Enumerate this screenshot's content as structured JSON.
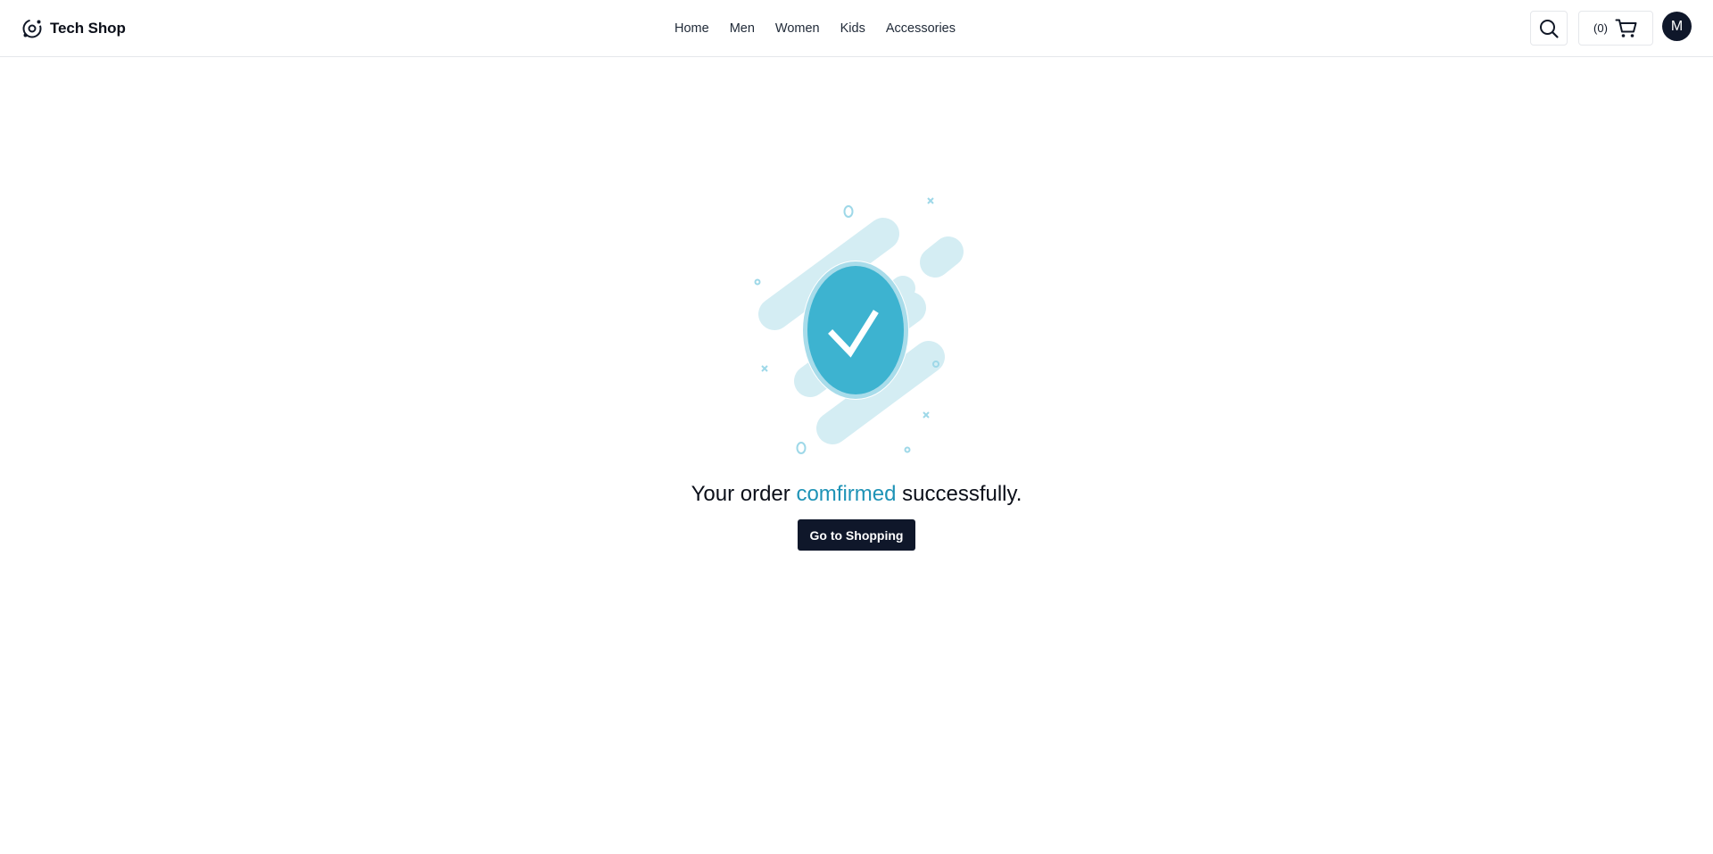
{
  "header": {
    "brand": "Tech Shop",
    "nav": [
      "Home",
      "Men",
      "Women",
      "Kids",
      "Accessories"
    ],
    "cart_count": "(0)",
    "avatar_initial": "M"
  },
  "main": {
    "message_prefix": "Your order",
    "message_accent": "comfirmed",
    "message_suffix": "successfully.",
    "button_label": "Go to Shopping"
  },
  "colors": {
    "primary": "#0f172a",
    "accent": "#1e93b6",
    "badge": "#3db3d0",
    "illustration_light": "#d4edf3"
  },
  "icons": {
    "brand": "brand-logo-icon",
    "search": "search-icon",
    "cart": "cart-icon",
    "success": "check-badge-icon"
  }
}
